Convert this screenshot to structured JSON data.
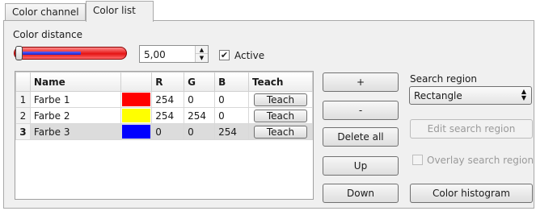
{
  "tabs": [
    {
      "label": "Color channel",
      "active": false
    },
    {
      "label": "Color list",
      "active": true
    }
  ],
  "color_distance": {
    "label": "Color distance",
    "slider_level": 0.05,
    "value": "5,00",
    "active_label": "Active",
    "active_checked": true
  },
  "table": {
    "headers": [
      "Name",
      "",
      "R",
      "G",
      "B",
      "Teach"
    ],
    "rows": [
      {
        "num": "1",
        "name": "Farbe 1",
        "color": "#ff0000",
        "r": "254",
        "g": "0",
        "b": "0",
        "teach": "Teach"
      },
      {
        "num": "2",
        "name": "Farbe 2",
        "color": "#ffff00",
        "r": "254",
        "g": "254",
        "b": "0",
        "teach": "Teach"
      },
      {
        "num": "3",
        "name": "Farbe 3",
        "color": "#0000ff",
        "r": "0",
        "g": "0",
        "b": "254",
        "teach": "Teach"
      }
    ],
    "selected_row": 3
  },
  "buttons": {
    "add": "+",
    "remove": "-",
    "delete_all": "Delete all",
    "up": "Up",
    "down": "Down"
  },
  "search_region": {
    "label": "Search region",
    "selected": "Rectangle",
    "edit_label": "Edit search region",
    "edit_enabled": false,
    "overlay_label": "Overlay search region",
    "overlay_checked": false,
    "overlay_enabled": false,
    "histogram_label": "Color histogram"
  },
  "icons": {
    "spin_up": "▲",
    "spin_down": "▼",
    "check": "✔"
  }
}
